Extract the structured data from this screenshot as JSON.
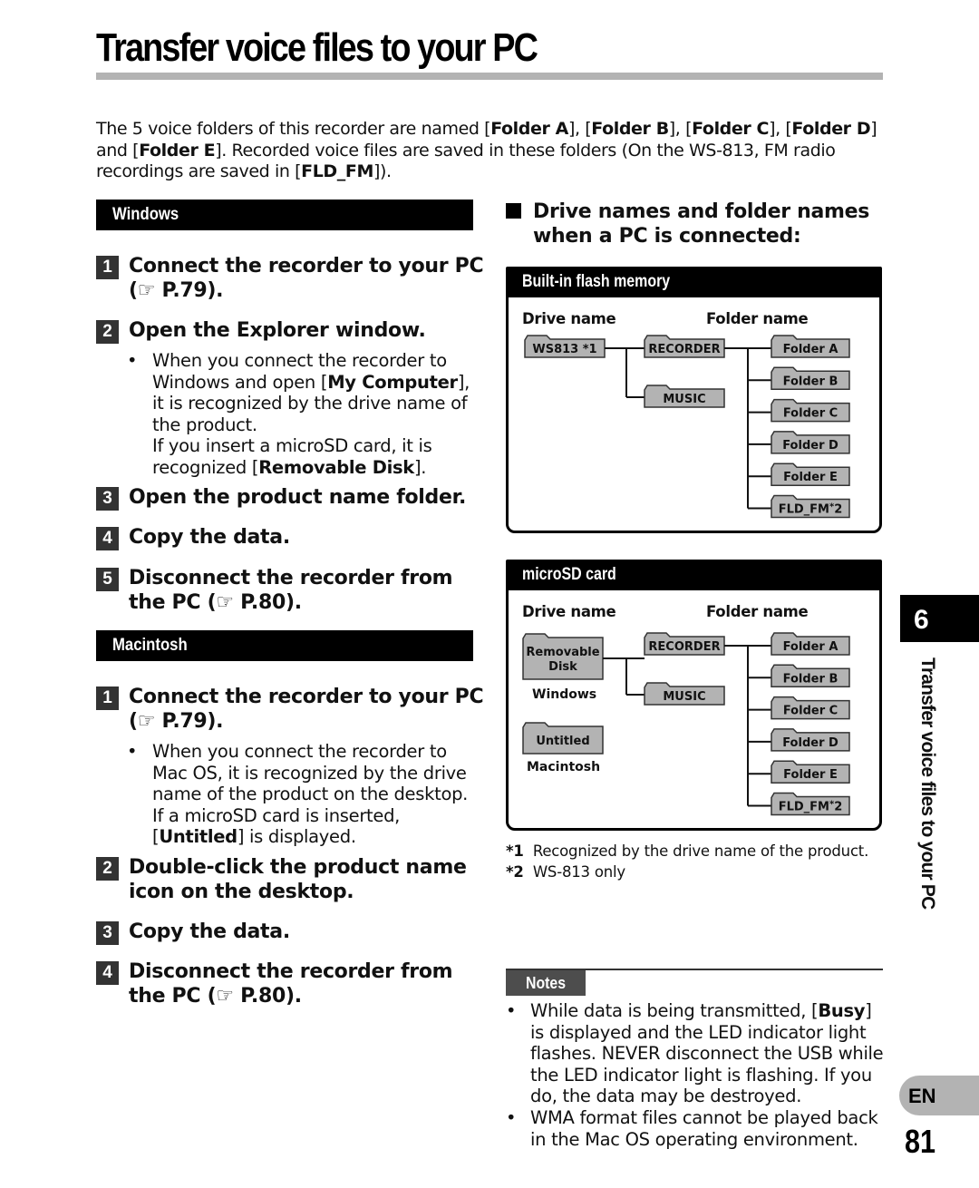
{
  "page": {
    "title": "Transfer voice files to your PC",
    "intro": {
      "parts": [
        {
          "t": "The 5 voice folders of this recorder are named [",
          "b": false
        },
        {
          "t": "Folder A",
          "b": true
        },
        {
          "t": "], [",
          "b": false
        },
        {
          "t": "Folder B",
          "b": true
        },
        {
          "t": "], [",
          "b": false
        },
        {
          "t": "Folder C",
          "b": true
        },
        {
          "t": "], [",
          "b": false
        },
        {
          "t": "Folder D",
          "b": true
        },
        {
          "t": "] and [",
          "b": false
        },
        {
          "t": "Folder E",
          "b": true
        },
        {
          "t": "]. Recorded voice files are saved in these folders (On the WS-813, FM radio recordings are saved in [",
          "b": false
        },
        {
          "t": "FLD_FM",
          "b": true
        },
        {
          "t": "]).",
          "b": false
        }
      ]
    },
    "chapter_number": "6",
    "side_title": "Transfer voice files to your PC",
    "language": "EN",
    "page_number": "81"
  },
  "windows": {
    "heading": "Windows",
    "steps": [
      {
        "num": "1",
        "text": "Connect the recorder to your PC",
        "ref": "(☞ P.79)."
      },
      {
        "num": "2",
        "text": "Open the Explorer window."
      },
      {
        "num": "3",
        "text": "Open the product name folder."
      },
      {
        "num": "4",
        "text": "Copy the data."
      },
      {
        "num": "5",
        "text": "Disconnect the recorder from the PC",
        "ref": "(☞ P.80)."
      }
    ],
    "step2_bullet": {
      "parts": [
        {
          "t": "When you connect the recorder to Windows and open [",
          "b": false
        },
        {
          "t": "My Computer",
          "b": true
        },
        {
          "t": "], it is recognized by the drive name of the product.",
          "b": false
        }
      ],
      "parts2": [
        {
          "t": "If you insert a microSD card, it is recognized [",
          "b": false
        },
        {
          "t": "Removable Disk",
          "b": true
        },
        {
          "t": "].",
          "b": false
        }
      ]
    }
  },
  "macintosh": {
    "heading": "Macintosh",
    "steps": [
      {
        "num": "1",
        "text": "Connect the recorder to your PC",
        "ref": "(☞ P.79)."
      },
      {
        "num": "2",
        "text": "Double-click the product name icon on the desktop."
      },
      {
        "num": "3",
        "text": "Copy the data."
      },
      {
        "num": "4",
        "text": "Disconnect the recorder from the PC",
        "ref": "(☞ P.80)."
      }
    ],
    "step1_bullet": {
      "parts": [
        {
          "t": "When you connect the recorder to Mac OS, it is recognized by the drive name of the product on the desktop. If a microSD card is inserted, [",
          "b": false
        },
        {
          "t": "Untitled",
          "b": true
        },
        {
          "t": "] is displayed.",
          "b": false
        }
      ]
    }
  },
  "drive_section": {
    "heading": "Drive names and folder names when a PC is connected:",
    "column_drive": "Drive name",
    "column_folder": "Folder name",
    "builtin": {
      "title": "Built-in flash memory",
      "drive": "WS813 *1",
      "top_folders": [
        "RECORDER",
        "MUSIC"
      ],
      "sub_folders": [
        "Folder A",
        "Folder B",
        "Folder C",
        "Folder D",
        "Folder E",
        "FLD_FM*2"
      ]
    },
    "microsd": {
      "title": "microSD card",
      "drive_windows": "Removable Disk",
      "drive_windows_os": "Windows",
      "drive_mac": "Untitled",
      "drive_mac_os": "Macintosh",
      "top_folders": [
        "RECORDER",
        "MUSIC"
      ],
      "sub_folders": [
        "Folder A",
        "Folder B",
        "Folder C",
        "Folder D",
        "Folder E",
        "FLD_FM*2"
      ]
    },
    "footnotes": [
      {
        "mark": "*1",
        "text": "Recognized by the drive name of the product."
      },
      {
        "mark": "*2",
        "text": "WS-813 only"
      }
    ]
  },
  "notes": {
    "label": "Notes",
    "items": [
      {
        "parts": [
          {
            "t": "While data is being transmitted, [",
            "b": false
          },
          {
            "t": "Busy",
            "b": true
          },
          {
            "t": "] is displayed and the LED indicator light flashes. NEVER disconnect the USB while the LED indicator light is flashing. If you do, the data may be destroyed.",
            "b": false
          }
        ]
      },
      {
        "parts": [
          {
            "t": "WMA format files cannot be played back in the Mac OS operating environment.",
            "b": false
          }
        ]
      }
    ]
  }
}
